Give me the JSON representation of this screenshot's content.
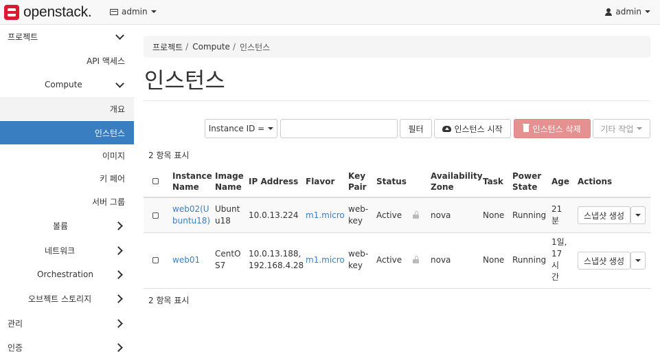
{
  "header": {
    "brand": "openstack.",
    "project": "admin",
    "user": "admin"
  },
  "sidebar": {
    "items": [
      {
        "label": "프로젝트",
        "state": "expanded"
      },
      {
        "label": "API 액세스"
      },
      {
        "label": "Compute",
        "state": "expanded"
      },
      {
        "label": "개요"
      },
      {
        "label": "인스턴스",
        "active": true
      },
      {
        "label": "이미지"
      },
      {
        "label": "키 페어"
      },
      {
        "label": "서버 그룹"
      },
      {
        "label": "볼륨",
        "state": "collapsed"
      },
      {
        "label": "네트워크",
        "state": "collapsed"
      },
      {
        "label": "Orchestration",
        "state": "collapsed"
      },
      {
        "label": "오브젝트 스토리지",
        "state": "collapsed"
      },
      {
        "label": "관리",
        "state": "collapsed"
      },
      {
        "label": "인증",
        "state": "collapsed"
      }
    ]
  },
  "breadcrumb": [
    "프로젝트",
    "Compute",
    "인스턴스"
  ],
  "page_title": "인스턴스",
  "toolbar": {
    "filter_field": "Instance ID =",
    "filter_value": "",
    "filter_button": "필터",
    "launch_button": "인스턴스 시작",
    "delete_button": "인스턴스 삭제",
    "more_actions": "기타 작업"
  },
  "item_count_top": "2 항목 표시",
  "item_count_bottom": "2 항목 표시",
  "table": {
    "columns": {
      "name": [
        "Instance",
        "Name"
      ],
      "image": [
        "Image",
        "Name"
      ],
      "ip": "IP Address",
      "flavor": "Flavor",
      "key": [
        "Key",
        "Pair"
      ],
      "status": "Status",
      "az": [
        "Availability",
        "Zone"
      ],
      "task": "Task",
      "power": [
        "Power",
        "State"
      ],
      "age": "Age",
      "actions": "Actions"
    },
    "rows": [
      {
        "name": [
          "web02(U",
          "buntu18)"
        ],
        "image": [
          "Ubunt",
          "u18"
        ],
        "ip": [
          "10.0.13.224"
        ],
        "flavor": "m1.micro",
        "key": [
          "web-",
          "key"
        ],
        "status": "Active",
        "az": "nova",
        "task": "None",
        "power": "Running",
        "age": [
          "21",
          "분"
        ],
        "action": "스냅샷 생성"
      },
      {
        "name": [
          "web01"
        ],
        "image": [
          "CentO",
          "S7"
        ],
        "ip": [
          "10.0.13.188,",
          "192.168.4.28"
        ],
        "flavor": "m1.micro",
        "key": [
          "web-",
          "key"
        ],
        "status": "Active",
        "az": "nova",
        "task": "None",
        "power": "Running",
        "age": [
          "1일,",
          "17",
          "시",
          "간"
        ],
        "action": "스냅샷 생성"
      }
    ]
  }
}
